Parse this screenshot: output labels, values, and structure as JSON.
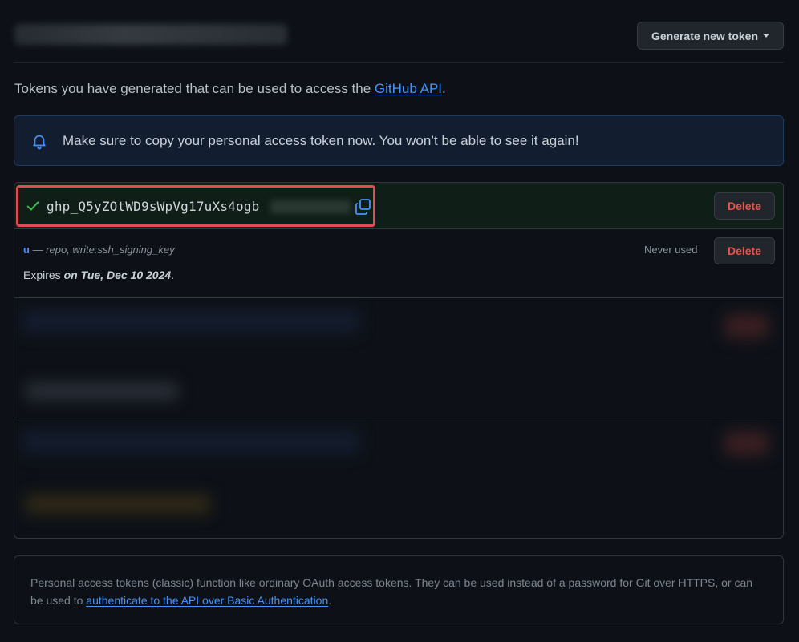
{
  "header": {
    "generate_button": "Generate new token"
  },
  "intro": {
    "prefix": "Tokens you have generated that can be used to access the ",
    "link": "GitHub API",
    "suffix": "."
  },
  "notice": {
    "text": "Make sure to copy your personal access token now. You won’t be able to see it again!"
  },
  "new_token": {
    "value": "ghp_Q5yZOtWD9sWpVg17uXs4ogb",
    "delete_label": "Delete"
  },
  "token": {
    "name": "u",
    "scopes": " — repo, write:ssh_signing_key",
    "expires_prefix": "Expires ",
    "expires_date": "on Tue, Dec 10 2024",
    "expires_suffix": ".",
    "last_used": "Never used",
    "delete_label": "Delete"
  },
  "footer": {
    "text": "Personal access tokens (classic) function like ordinary OAuth access tokens. They can be used instead of a password for Git over HTTPS, or can be used to ",
    "link": "authenticate to the API over Basic Authentication",
    "suffix": "."
  },
  "colors": {
    "accent": "#4493f8",
    "danger": "#e5534b",
    "highlight_border": "#e04b58",
    "success": "#3fb950"
  }
}
